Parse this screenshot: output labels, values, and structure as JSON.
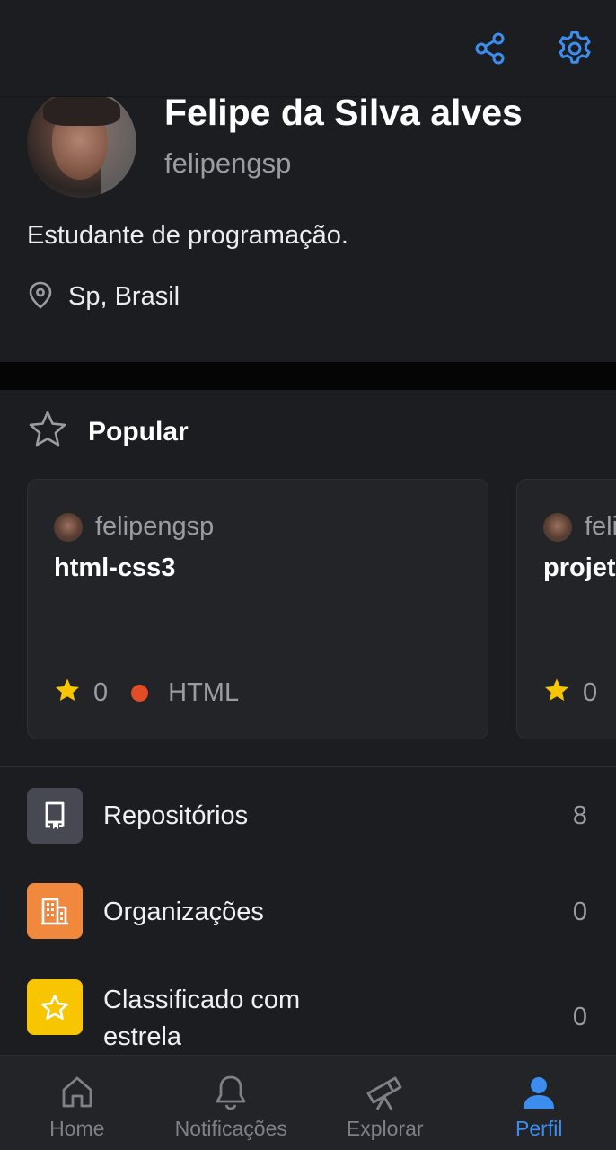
{
  "colors": {
    "accent": "#3b8ef0",
    "background": "#1c1d21",
    "card": "#232428",
    "html_language": "#e34c26",
    "star": "#f7c600",
    "orgs_icon": "#f0883e",
    "repos_icon": "#464852"
  },
  "topbar": {
    "share_icon": "share-icon",
    "settings_icon": "gear-icon"
  },
  "profile": {
    "name": "Felipe da Silva alves",
    "username": "felipengsp",
    "bio": "Estudante de programação.",
    "location": "Sp, Brasil"
  },
  "popular": {
    "title": "Popular",
    "cards": [
      {
        "owner": "felipengsp",
        "repo": "html-css3",
        "stars": "0",
        "language": "HTML"
      },
      {
        "owner": "felipengsp",
        "repo": "projeto",
        "stars": "0",
        "language": ""
      }
    ]
  },
  "list": [
    {
      "label": "Repositórios",
      "count": "8",
      "icon": "repo-icon"
    },
    {
      "label": "Organizações",
      "count": "0",
      "icon": "organization-icon"
    },
    {
      "label": "Classificado com estrela",
      "count": "0",
      "icon": "star-icon"
    }
  ],
  "bottom_nav": {
    "active": "Perfil",
    "items": [
      {
        "label": "Home",
        "icon": "home-icon"
      },
      {
        "label": "Notificações",
        "icon": "bell-icon"
      },
      {
        "label": "Explorar",
        "icon": "telescope-icon"
      },
      {
        "label": "Perfil",
        "icon": "person-icon"
      }
    ]
  }
}
